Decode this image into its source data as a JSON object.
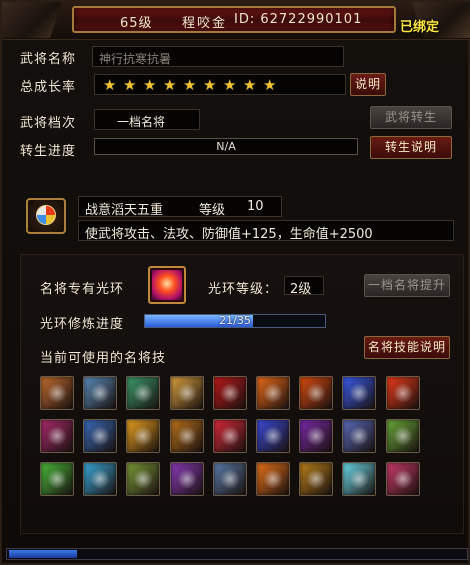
{
  "title": {
    "level": "65级",
    "name": "程咬金",
    "id": "ID: 62722990101",
    "bound": "已绑定"
  },
  "form": {
    "name_label": "武将名称",
    "name_placeholder": "神行抗寒抗暑",
    "growth_label": "总成长率",
    "growth_stars": 9,
    "explain_button": "说明",
    "tier_label": "武将档次",
    "tier_value": "一档名将",
    "rebirth_button": "武将转生",
    "rebirth_progress_label": "转生进度",
    "rebirth_progress_value": "N/A",
    "rebirth_explain_button": "转生说明"
  },
  "rank": {
    "title_name": "战意滔天五重",
    "level_label": "等级",
    "level_value": "10",
    "effect": "使武将攻击、法攻、防御值+125，生命值+2500"
  },
  "aura": {
    "label": "名将专有光环",
    "level_label": "光环等级：",
    "level_value": "2级",
    "upgrade_button": "一档名将提升",
    "train_label": "光环修炼进度",
    "train_text": "21/35",
    "train_current": 21,
    "train_total": 35,
    "skills_label": "当前可使用的名将技",
    "skills_explain_button": "名将技能说明"
  },
  "skills": [
    {
      "name": "axe-skill-icon",
      "color": "#c06a30"
    },
    {
      "name": "hammer-skill-icon",
      "color": "#5a8ab8"
    },
    {
      "name": "crescent-skill-icon",
      "color": "#3a9a6a"
    },
    {
      "name": "blade-rain-skill-icon",
      "color": "#d8a040"
    },
    {
      "name": "crimson-slash-skill-icon",
      "color": "#b81a1a"
    },
    {
      "name": "flame-slash-skill-icon",
      "color": "#e86a1a"
    },
    {
      "name": "flame-sword-skill-icon",
      "color": "#d84a10"
    },
    {
      "name": "lightning-skill-icon",
      "color": "#3a5ae8"
    },
    {
      "name": "fire-burst-skill-icon",
      "color": "#e83a1a"
    },
    {
      "name": "shadow-claw-skill-icon",
      "color": "#a82a6a"
    },
    {
      "name": "frost-wing-skill-icon",
      "color": "#3a6ab8"
    },
    {
      "name": "phoenix-skill-icon",
      "color": "#e8a020"
    },
    {
      "name": "dragon-skill-icon",
      "color": "#b8701a"
    },
    {
      "name": "heart-skill-icon",
      "color": "#d82a3a"
    },
    {
      "name": "vortex-skill-icon",
      "color": "#3a4ad8"
    },
    {
      "name": "demon-skill-icon",
      "color": "#7a2aa8"
    },
    {
      "name": "spiral-skill-icon",
      "color": "#5a6ab8"
    },
    {
      "name": "poison-skill-icon",
      "color": "#6aa83a"
    },
    {
      "name": "nature-skill-icon",
      "color": "#4ab83a"
    },
    {
      "name": "ice-hand-skill-icon",
      "color": "#3aa8d8"
    },
    {
      "name": "rock-skill-icon",
      "color": "#7a9a3a"
    },
    {
      "name": "wizard-skill-icon",
      "color": "#8a3ab8"
    },
    {
      "name": "pillar-skill-icon",
      "color": "#5a7aa8"
    },
    {
      "name": "fire-wave-skill-icon",
      "color": "#e8701a"
    },
    {
      "name": "earth-guard-skill-icon",
      "color": "#b8801a"
    },
    {
      "name": "holy-light-skill-icon",
      "color": "#6ad8e8"
    },
    {
      "name": "berserk-skill-icon",
      "color": "#c83a6a"
    }
  ]
}
